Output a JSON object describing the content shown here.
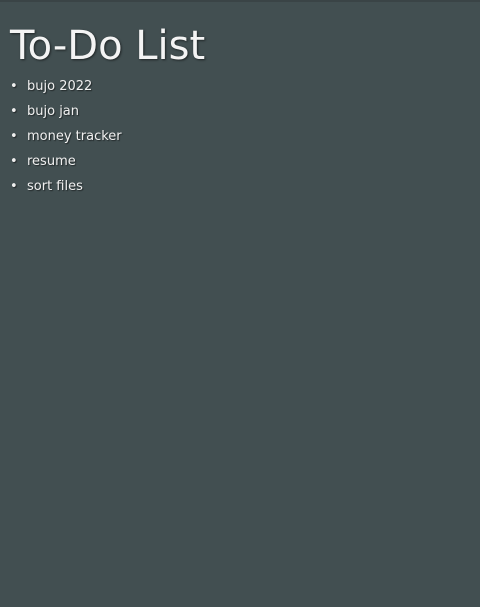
{
  "title": "To-Do List",
  "bullet_glyph": "•",
  "todo": {
    "items": [
      {
        "label": "bujo 2022"
      },
      {
        "label": "bujo jan"
      },
      {
        "label": "money tracker"
      },
      {
        "label": "resume"
      },
      {
        "label": "sort files"
      }
    ]
  },
  "colors": {
    "background": "#424f51",
    "text": "#f0f0f0"
  }
}
